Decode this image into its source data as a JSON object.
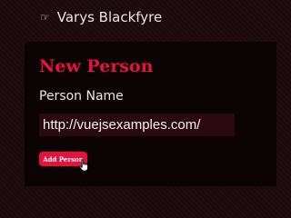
{
  "person_list": {
    "items": [
      {
        "icon": "pointing-hand-icon",
        "name": "Varys Blackfyre"
      }
    ]
  },
  "form": {
    "title": "New Person",
    "name_label": "Person Name",
    "name_value": "http://vuejsexamples.com/",
    "add_button_label": "Add Person"
  },
  "colors": {
    "accent": "#e5123e",
    "background": "#1c0a0e",
    "panel": "#0c0304"
  }
}
